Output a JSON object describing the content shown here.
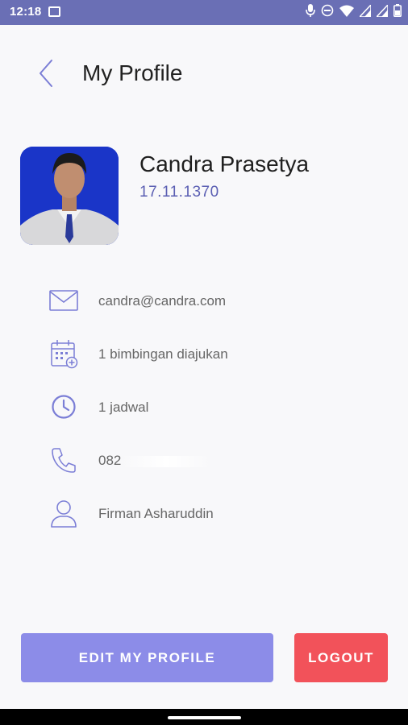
{
  "status_bar": {
    "time": "12:18"
  },
  "header": {
    "title": "My Profile"
  },
  "profile": {
    "name": "Candra Prasetya",
    "id_number": "17.11.1370"
  },
  "info": {
    "email": "candra@candra.com",
    "guidance": "1 bimbingan diajukan",
    "schedule": "1 jadwal",
    "phone_prefix": "082",
    "advisor": "Firman Asharuddin"
  },
  "actions": {
    "edit_label": "EDIT MY PROFILE",
    "logout_label": "LOGOUT"
  },
  "colors": {
    "status_bar": "#6a6fb5",
    "accent": "#5b5fb3",
    "edit_button": "#8c8ce8",
    "logout_button": "#f2525a"
  }
}
